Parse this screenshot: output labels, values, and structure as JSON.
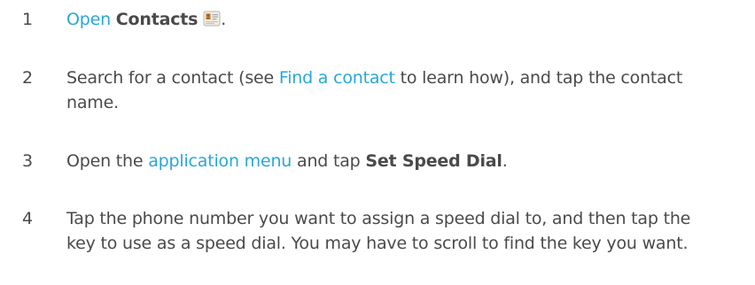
{
  "steps": [
    {
      "number": "1",
      "link_text": "Open",
      "bold_text": "Contacts",
      "icon": "contacts-app-icon",
      "trailing": "."
    },
    {
      "number": "2",
      "before": "Search for a contact (see ",
      "link_text": "Find a contact",
      "after": " to learn how), and tap the contact name."
    },
    {
      "number": "3",
      "before": "Open the ",
      "link_text": "application menu",
      "middle": " and tap ",
      "bold_text": "Set Speed Dial",
      "trailing": "."
    },
    {
      "number": "4",
      "text": "Tap the phone number you want to assign a speed dial to, and then tap the key to use as a speed dial. You may have to scroll to find the key you want."
    }
  ],
  "colors": {
    "body_text": "#4a4a4a",
    "link": "#2aa7d6"
  }
}
